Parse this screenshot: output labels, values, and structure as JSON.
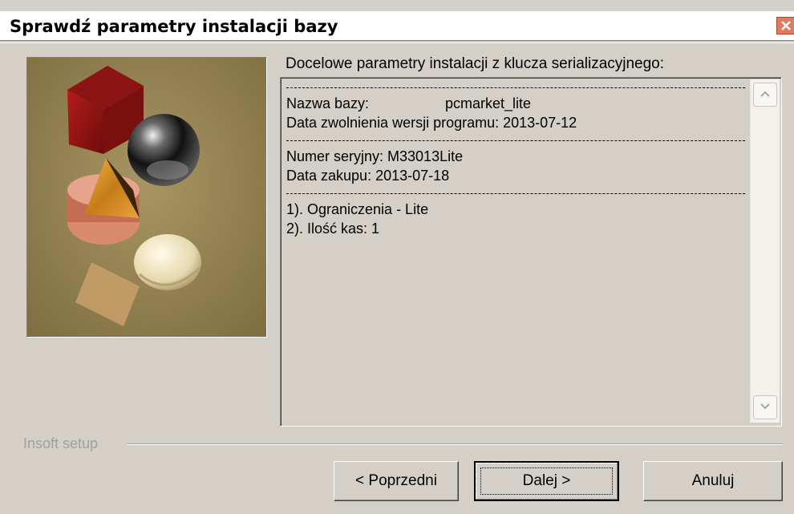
{
  "window": {
    "title": "Sprawdź parametry instalacji bazy",
    "close_icon": "close-icon"
  },
  "content": {
    "params_label": "Docelowe parametry instalacji z klucza serializacyjnego:",
    "database_name_label": "Nazwa bazy:",
    "database_name_value": "pcmarket_lite",
    "release_date": "Data zwolnienia wersji programu: 2013-07-12",
    "serial_number": "Numer seryjny: M33013Lite",
    "purchase_date": "Data zakupu: 2013-07-18",
    "limit_1": "1). Ograniczenia - Lite",
    "limit_2": "2). Ilość kas: 1"
  },
  "footer": {
    "group_label": "Insoft setup",
    "prev_label": "< Poprzedni",
    "next_label": "Dalej >",
    "cancel_label": "Anuluj"
  },
  "colors": {
    "background": "#d4d0c8",
    "close_button": "#e07b63",
    "illustration_bg": "#8f7e4b"
  }
}
